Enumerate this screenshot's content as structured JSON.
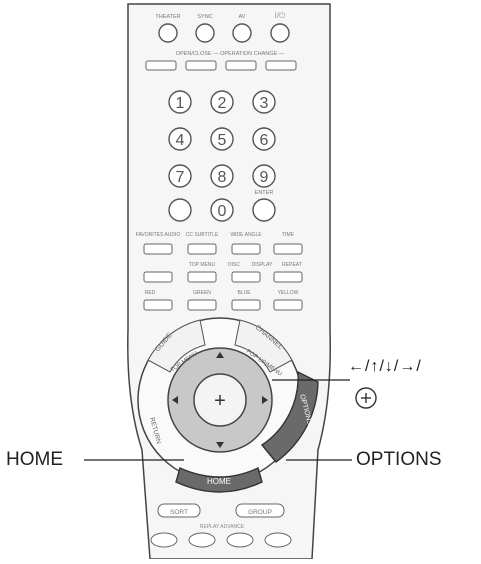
{
  "callouts": {
    "home": "HOME",
    "options": "OPTIONS",
    "arrows": "←/↑/↓/→/",
    "enter_symbol": "+"
  },
  "remote": {
    "top_buttons": [
      "THEATER",
      "SYNC",
      "AV",
      "I/⏻"
    ],
    "open_close_label": "OPEN/CLOSE  — OPERATION CHANGE —",
    "mode_buttons": [
      "",
      "",
      "",
      ""
    ],
    "digits": [
      "1",
      "2",
      "3",
      "4",
      "5",
      "6",
      "7",
      "8",
      "9",
      "0"
    ],
    "enter_label": "ENTER",
    "fn_row_labels": [
      "FAVORITES AUDIO",
      "CC SUBTITLE",
      "WIDE ANGLE",
      "TIME"
    ],
    "fn_row2_labels": [
      "TOP MENU",
      "DISC",
      "DISPLAY",
      "REPEAT"
    ],
    "color_labels": [
      "RED",
      "GREEN",
      "BLUE",
      "YELLOW"
    ],
    "ring_labels": {
      "guide": "GUIDE",
      "top_menu": "TOP MENU",
      "channel": "CHANNEL",
      "pop_up_menu": "POP UP/MENU",
      "return": "RETURN",
      "options_vertical": "OPTIONS",
      "home_key": "HOME"
    },
    "sort_label": "SORT",
    "group_label": "GROUP",
    "transport_labels": "REPLAY ADVANCE"
  }
}
